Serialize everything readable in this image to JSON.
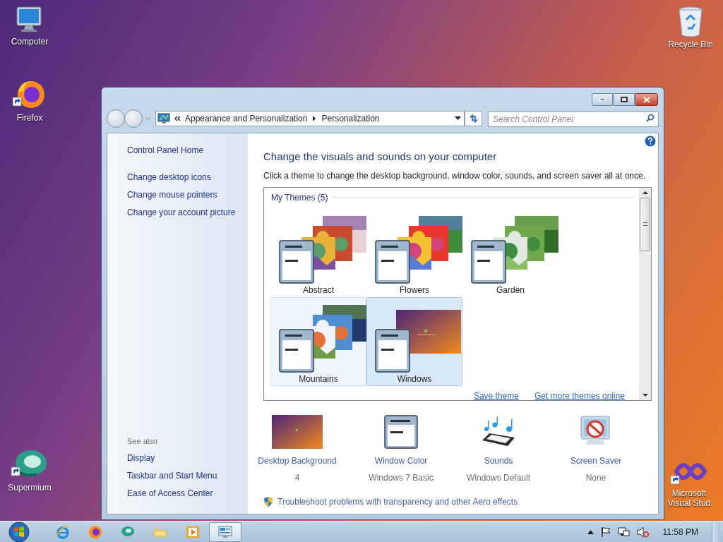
{
  "desktop_icons": [
    {
      "kind": "computer",
      "label": "Computer"
    },
    {
      "kind": "firefox",
      "label": "Firefox"
    },
    {
      "kind": "supermium",
      "label": "Supermium"
    },
    {
      "kind": "recycle",
      "label": "Recycle Bin"
    },
    {
      "kind": "vs",
      "label": "Microsoft Visual Stud"
    }
  ],
  "window": {
    "address": {
      "crumbs": [
        "Appearance and Personalization",
        "Personalization"
      ]
    },
    "search": {
      "placeholder": "Search Control Panel"
    },
    "sidebar": {
      "home": "Control Panel Home",
      "links": [
        "Change desktop icons",
        "Change mouse pointers",
        "Change your account picture"
      ],
      "see_also_title": "See also",
      "see_also": [
        "Display",
        "Taskbar and Start Menu",
        "Ease of Access Center"
      ]
    },
    "heading": "Change the visuals and sounds on your computer",
    "description": "Click a theme to change the desktop background, window color, sounds, and screen saver all at once.",
    "themes": {
      "group_title": "My Themes (5)",
      "items": [
        {
          "name": "Abstract",
          "selected": false,
          "hovered": false
        },
        {
          "name": "Flowers",
          "selected": false,
          "hovered": false
        },
        {
          "name": "Garden",
          "selected": false,
          "hovered": false
        },
        {
          "name": "Mountains",
          "selected": false,
          "hovered": true
        },
        {
          "name": "Windows",
          "selected": true,
          "hovered": false
        }
      ],
      "links": [
        "Save theme",
        "Get more themes online"
      ]
    },
    "settings": [
      {
        "kind": "background",
        "label": "Desktop Background",
        "value": "4"
      },
      {
        "kind": "color",
        "label": "Window Color",
        "value": "Windows 7 Basic"
      },
      {
        "kind": "sounds",
        "label": "Sounds",
        "value": "Windows Default"
      },
      {
        "kind": "screensaver",
        "label": "Screen Saver",
        "value": "None"
      }
    ],
    "troubleshoot": "Troubleshoot problems with transparency and other Aero effects"
  },
  "taskbar": {
    "apps": [
      {
        "kind": "ie",
        "active": false
      },
      {
        "kind": "firefox",
        "active": false
      },
      {
        "kind": "supermium",
        "active": false
      },
      {
        "kind": "explorer",
        "active": false
      },
      {
        "kind": "media",
        "active": false
      },
      {
        "kind": "control",
        "active": true
      }
    ],
    "clock": "11:58 PM"
  }
}
